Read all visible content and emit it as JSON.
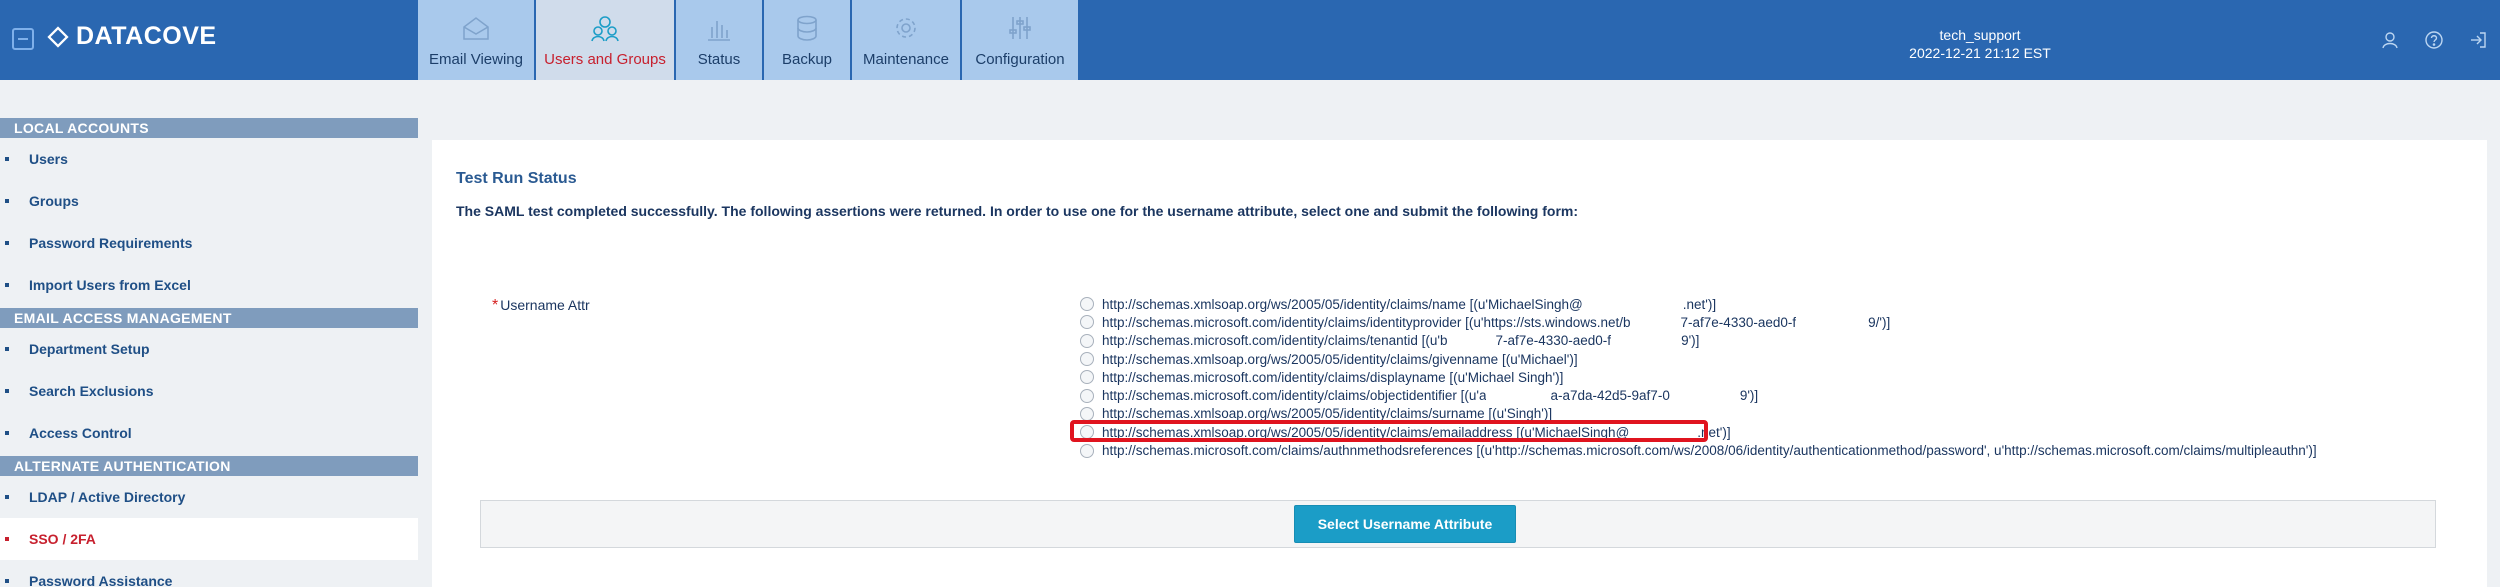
{
  "brand": {
    "name": "DATACOVE"
  },
  "tabs": [
    {
      "label": "Email Viewing",
      "icon": "envelope-icon"
    },
    {
      "label": "Users and Groups",
      "icon": "users-icon",
      "active": true
    },
    {
      "label": "Status",
      "icon": "bar-chart-icon"
    },
    {
      "label": "Backup",
      "icon": "database-icon"
    },
    {
      "label": "Maintenance",
      "icon": "gear-icon"
    },
    {
      "label": "Configuration",
      "icon": "sliders-icon"
    }
  ],
  "user": {
    "name": "tech_support",
    "datetime": "2022-12-21 21:12 EST"
  },
  "top_icons": [
    "user-icon",
    "help-icon",
    "logout-icon"
  ],
  "sidebar": {
    "sections": [
      {
        "title": "LOCAL ACCOUNTS",
        "items": [
          "Users",
          "Groups",
          "Password Requirements",
          "Import Users from Excel"
        ]
      },
      {
        "title": "EMAIL ACCESS MANAGEMENT",
        "items": [
          "Department Setup",
          "Search Exclusions",
          "Access Control"
        ]
      },
      {
        "title": "ALTERNATE AUTHENTICATION",
        "items": [
          "LDAP / Active Directory",
          "SSO / 2FA",
          "Password Assistance"
        ]
      }
    ],
    "active_item": "SSO / 2FA"
  },
  "main": {
    "title": "Test Run Status",
    "description": "The SAML test completed successfully. The following assertions were returned. In order to use one for the username attribute, select one and submit the following form:",
    "field_label": "Username Attr",
    "required_mark": "*",
    "options": [
      {
        "pre": "http://schemas.xmlsoap.org/ws/2005/05/identity/claims/name [(u'MichaelSingh@",
        "post": ".net')]"
      },
      {
        "pre": "http://schemas.microsoft.com/identity/claims/identityprovider [(u'https://sts.windows.net/b",
        "mid": "7-af7e-4330-aed0-f",
        "post": "9/')]"
      },
      {
        "pre": "http://schemas.microsoft.com/identity/claims/tenantid [(u'b",
        "mid": "7-af7e-4330-aed0-f",
        "post": "9')]"
      },
      {
        "pre": "http://schemas.xmlsoap.org/ws/2005/05/identity/claims/givenname [(u'Michael')]"
      },
      {
        "pre": "http://schemas.microsoft.com/identity/claims/displayname [(u'Michael Singh')]"
      },
      {
        "pre": "http://schemas.microsoft.com/identity/claims/objectidentifier [(u'a",
        "mid": "a-a7da-42d5-9af7-0",
        "post": "9')]"
      },
      {
        "pre": "http://schemas.xmlsoap.org/ws/2005/05/identity/claims/surname [(u'Singh')]"
      },
      {
        "pre": "http://schemas.xmlsoap.org/ws/2005/05/identity/claims/emailaddress [(u'MichaelSingh@",
        "post": ".net')]"
      },
      {
        "pre": "http://schemas.microsoft.com/claims/authnmethodsreferences [(u'http://schemas.microsoft.com/ws/2008/06/identity/authenticationmethod/password', u'http://schemas.microsoft.com/claims/multipleauthn')]"
      }
    ],
    "submit_label": "Select Username Attribute"
  }
}
